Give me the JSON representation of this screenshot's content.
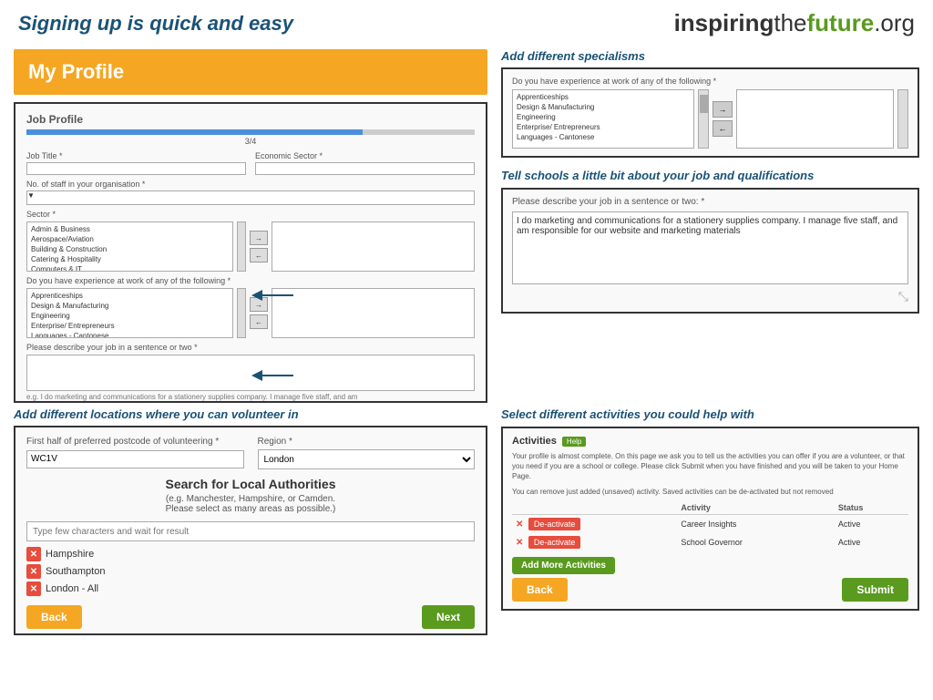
{
  "header": {
    "title": "Signing up is quick and easy",
    "logo_inspiring": "inspiring",
    "logo_the": "the",
    "logo_future": "future",
    "logo_org": ".org"
  },
  "my_profile": {
    "label": "My Profile"
  },
  "job_profile": {
    "title": "Job Profile",
    "progress": "3/4",
    "job_title_label": "Job Title *",
    "economic_sector_label": "Economic Sector *",
    "staff_count_label": "No. of staff in your organisation *",
    "sector_label": "Sector *",
    "sector_items": [
      "Admin & Business",
      "Aerospace/Aviation",
      "Building & Construction",
      "Catering & Hospitality",
      "Computers & IT"
    ],
    "experience_label": "Do you have experience at work of any of the following *",
    "experience_items": [
      "Apprenticeships",
      "Design & Manufacturing",
      "Engineering",
      "Enterprise/ Entrepreneurs",
      "Languages - Cantonese"
    ],
    "describe_label": "Please describe your job in a sentence or two *",
    "describe_hint": "e.g. I do marketing and communications for a stationery supplies company. I manage five staff, and am"
  },
  "specialisms": {
    "heading": "Add different specialisms",
    "experience_label": "Do you have experience at work of any of the following *",
    "items": [
      "Apprenticeships",
      "Design & Manufacturing",
      "Engineering",
      "Enterprise/ Entrepreneurs",
      "Languages - Cantonese"
    ]
  },
  "tell_schools": {
    "heading": "Tell schools a little bit about your job and qualifications",
    "label": "Please describe your job in a sentence or two: *",
    "text": "I do marketing and communications for a stationery supplies company. I manage five staff, and am responsible for our website and marketing materials"
  },
  "location": {
    "heading": "Add different locations where you can volunteer in",
    "postcode_label": "First half of preferred postcode of volunteering *",
    "postcode_value": "WC1V",
    "region_label": "Region *",
    "region_value": "London",
    "search_heading": "Search for Local Authorities",
    "search_sub": "(e.g. Manchester, Hampshire, or Camden.\nPlease select as many areas as possible.)",
    "search_placeholder": "Type few characters and wait for result",
    "tags": [
      "Hampshire",
      "Southampton",
      "London - All"
    ],
    "back_label": "Back",
    "next_label": "Next"
  },
  "activities": {
    "heading": "Select different activities you could help with",
    "title": "Activities",
    "help_label": "Help",
    "desc1": "Your profile is almost complete. On this page we ask you to tell us the activities you can offer if you are a volunteer, or that you need if you are a school or college. Please click Submit when you have finished and you will be taken to your Home Page.",
    "desc2": "You can remove just added (unsaved) activity. Saved activities can be de-activated but not removed",
    "col_activity": "Activity",
    "col_status": "Status",
    "rows": [
      {
        "activity": "Career Insights",
        "status": "Active"
      },
      {
        "activity": "School Governor",
        "status": "Active"
      }
    ],
    "deactivate_label": "De-activate",
    "add_more_label": "Add More Activities",
    "back_label": "Back",
    "submit_label": "Submit"
  }
}
